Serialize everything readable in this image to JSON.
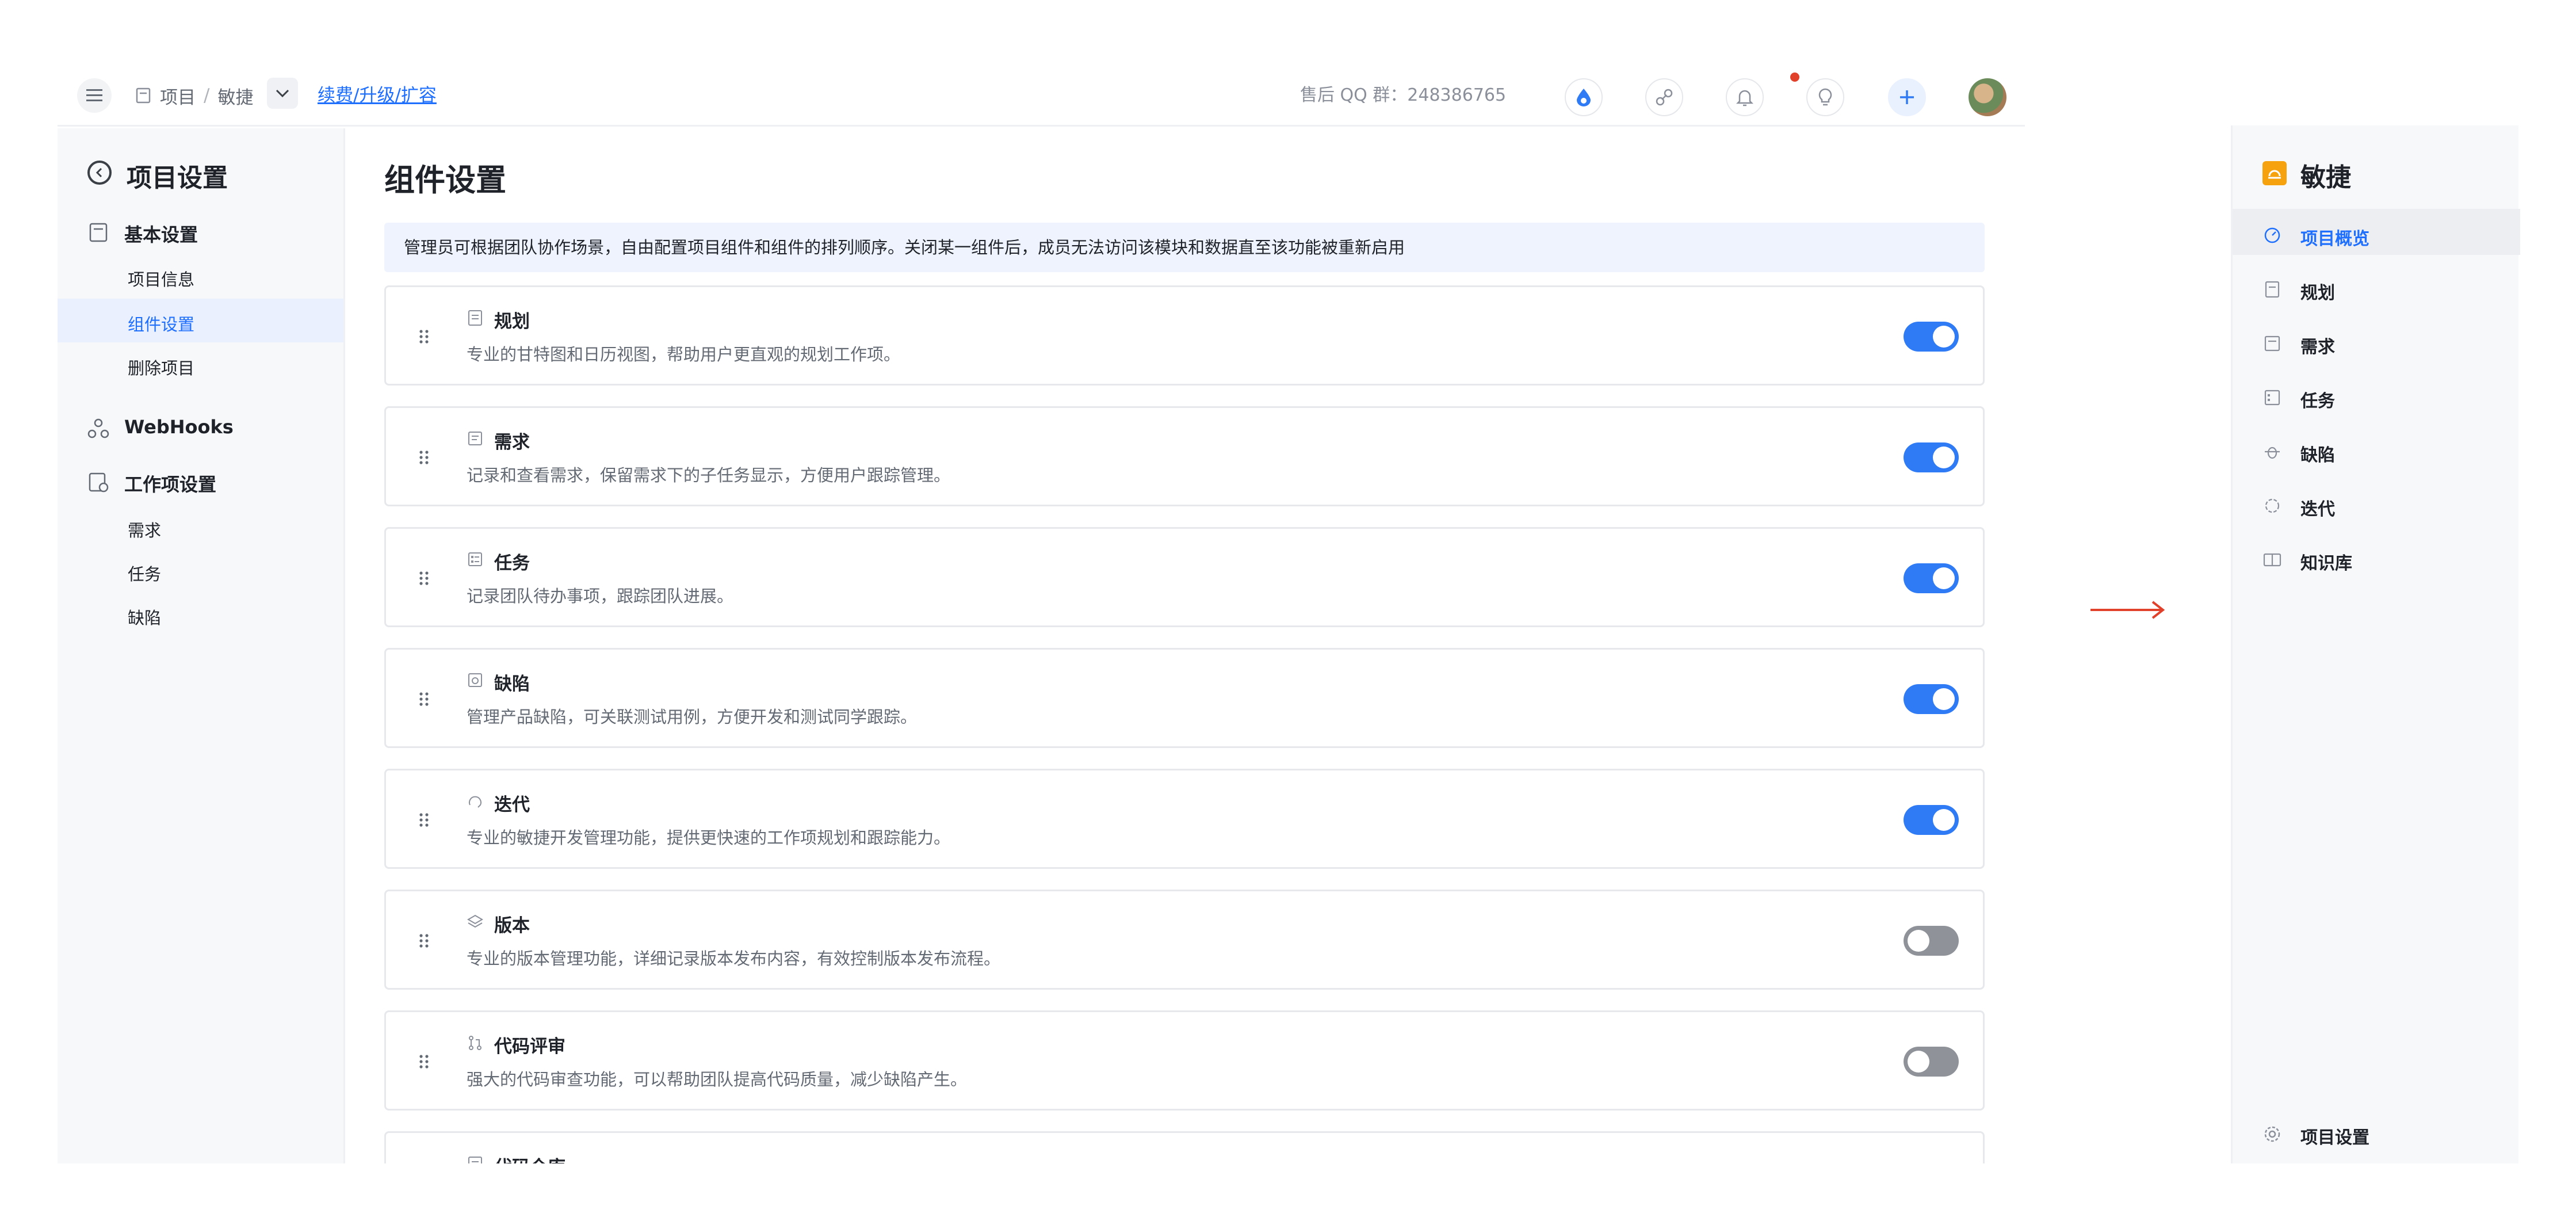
{
  "topbar": {
    "crumb_project": "项目",
    "crumb_sep": "/",
    "crumb_agile": "敏捷",
    "upgrade_link": "续费/升级/扩容",
    "support_qq": "售后 QQ 群：248386765"
  },
  "settings_sidebar": {
    "title": "项目设置",
    "basic_group": "基本设置",
    "basic_items": [
      "项目信息",
      "组件设置",
      "删除项目"
    ],
    "webhooks": "WebHooks",
    "workitem_group": "工作项设置",
    "workitem_items": [
      "需求",
      "任务",
      "缺陷"
    ]
  },
  "main": {
    "title": "组件设置",
    "notice": "管理员可根据团队协作场景，自由配置项目组件和组件的排列顺序。关闭某一组件后，成员无法访问该模块和数据直至该功能被重新启用",
    "components": [
      {
        "name": "规划",
        "desc": "专业的甘特图和日历视图，帮助用户更直观的规划工作项。",
        "icon": "planning-icon",
        "enabled": true
      },
      {
        "name": "需求",
        "desc": "记录和查看需求，保留需求下的子任务显示，方便用户跟踪管理。",
        "icon": "requirement-icon",
        "enabled": true
      },
      {
        "name": "任务",
        "desc": "记录团队待办事项，跟踪团队进展。",
        "icon": "task-icon",
        "enabled": true
      },
      {
        "name": "缺陷",
        "desc": "管理产品缺陷，可关联测试用例，方便开发和测试同学跟踪。",
        "icon": "bug-icon",
        "enabled": true
      },
      {
        "name": "迭代",
        "desc": "专业的敏捷开发管理功能，提供更快速的工作项规划和跟踪能力。",
        "icon": "iteration-icon",
        "enabled": true
      },
      {
        "name": "版本",
        "desc": "专业的版本管理功能，详细记录版本发布内容，有效控制版本发布流程。",
        "icon": "version-icon",
        "enabled": false
      },
      {
        "name": "代码评审",
        "desc": "强大的代码审查功能，可以帮助团队提高代码质量，减少缺陷产生。",
        "icon": "code-review-icon",
        "enabled": false
      },
      {
        "name": "代码仓库",
        "desc": "",
        "icon": "code-repo-icon",
        "enabled": false
      }
    ]
  },
  "preview": {
    "title": "敏捷",
    "items": [
      "项目概览",
      "规划",
      "需求",
      "任务",
      "缺陷",
      "迭代",
      "知识库"
    ],
    "footer": "项目设置"
  },
  "colors": {
    "accent": "#2f7bf6",
    "toggle_off": "#8f9399",
    "logo": "#f6a20f",
    "arrow": "#e1402b"
  }
}
